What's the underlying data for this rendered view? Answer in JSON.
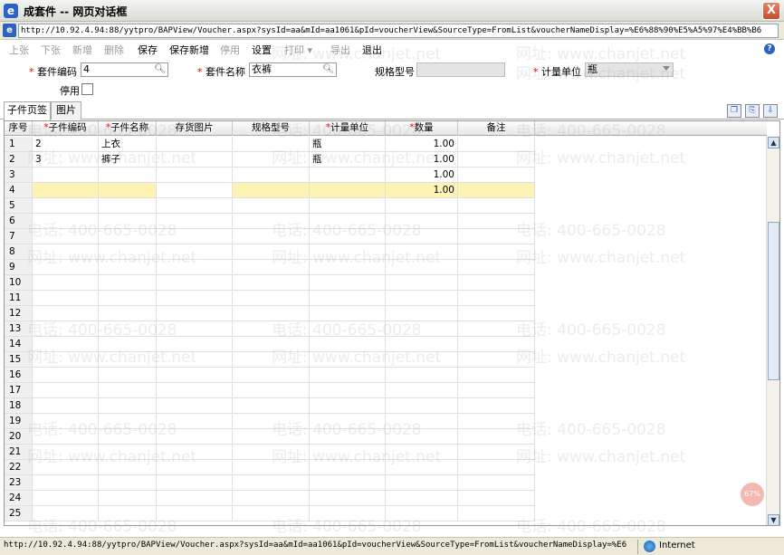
{
  "window": {
    "title": "成套件  -- 网页对话框",
    "close_label": "X"
  },
  "address": {
    "url": "http://10.92.4.94:88/yytpro/BAPView/Voucher.aspx?sysId=aa&mId=aa1061&pId=voucherView&SourceType=FromList&voucherNameDisplay=%E6%88%90%E5%A5%97%E4%BB%B6"
  },
  "toolbar": {
    "prev": "上张",
    "next": "下张",
    "new": "新增",
    "delete": "删除",
    "save": "保存",
    "save_new": "保存新增",
    "disable": "停用",
    "settings": "设置",
    "print": "打印 ▾",
    "export": "导出",
    "exit": "退出",
    "help": "?"
  },
  "form": {
    "code_label": "套件编码",
    "code_value": "4",
    "name_label": "套件名称",
    "name_value": "衣裤",
    "spec_label": "规格型号",
    "spec_value": "",
    "unit_label": "计量单位",
    "unit_value": "瓶",
    "disabled_label": "停用",
    "required_mark": "*"
  },
  "tabs": [
    "子件页签",
    "图片"
  ],
  "grid": {
    "headers": [
      "序号",
      "子件编码",
      "子件名称",
      "存货图片",
      "规格型号",
      "计量单位",
      "数量",
      "备注"
    ],
    "required_cols": [
      false,
      true,
      true,
      false,
      false,
      true,
      true,
      false
    ],
    "rows": [
      [
        "1",
        "2",
        "上衣",
        "",
        "",
        "瓶",
        "1.00",
        ""
      ],
      [
        "2",
        "3",
        "裤子",
        "",
        "",
        "瓶",
        "1.00",
        ""
      ],
      [
        "3",
        "",
        "",
        "",
        "",
        "",
        "1.00",
        ""
      ],
      [
        "4",
        "",
        "",
        "",
        "",
        "",
        "1.00",
        ""
      ],
      [
        "5",
        "",
        "",
        "",
        "",
        "",
        "",
        ""
      ],
      [
        "6",
        "",
        "",
        "",
        "",
        "",
        "",
        ""
      ],
      [
        "7",
        "",
        "",
        "",
        "",
        "",
        "",
        ""
      ],
      [
        "8",
        "",
        "",
        "",
        "",
        "",
        "",
        ""
      ],
      [
        "9",
        "",
        "",
        "",
        "",
        "",
        "",
        ""
      ],
      [
        "10",
        "",
        "",
        "",
        "",
        "",
        "",
        ""
      ],
      [
        "11",
        "",
        "",
        "",
        "",
        "",
        "",
        ""
      ],
      [
        "12",
        "",
        "",
        "",
        "",
        "",
        "",
        ""
      ],
      [
        "13",
        "",
        "",
        "",
        "",
        "",
        "",
        ""
      ],
      [
        "14",
        "",
        "",
        "",
        "",
        "",
        "",
        ""
      ],
      [
        "15",
        "",
        "",
        "",
        "",
        "",
        "",
        ""
      ],
      [
        "16",
        "",
        "",
        "",
        "",
        "",
        "",
        ""
      ],
      [
        "17",
        "",
        "",
        "",
        "",
        "",
        "",
        ""
      ],
      [
        "18",
        "",
        "",
        "",
        "",
        "",
        "",
        ""
      ],
      [
        "19",
        "",
        "",
        "",
        "",
        "",
        "",
        ""
      ],
      [
        "20",
        "",
        "",
        "",
        "",
        "",
        "",
        ""
      ],
      [
        "21",
        "",
        "",
        "",
        "",
        "",
        "",
        ""
      ],
      [
        "22",
        "",
        "",
        "",
        "",
        "",
        "",
        ""
      ],
      [
        "23",
        "",
        "",
        "",
        "",
        "",
        "",
        ""
      ],
      [
        "24",
        "",
        "",
        "",
        "",
        "",
        "",
        ""
      ],
      [
        "25",
        "",
        "",
        "",
        "",
        "",
        "",
        ""
      ]
    ],
    "selected_row": 3
  },
  "watermarks": {
    "phone": "电话: 400-665-0028",
    "site": "网址: www.chanjet.net"
  },
  "badge": "67%",
  "status": {
    "url": "http://10.92.4.94:88/yytpro/BAPView/Voucher.aspx?sysId=aa&mId=aa1061&pId=voucherView&SourceType=FromList&voucherNameDisplay=%E6",
    "zone": "Internet"
  }
}
